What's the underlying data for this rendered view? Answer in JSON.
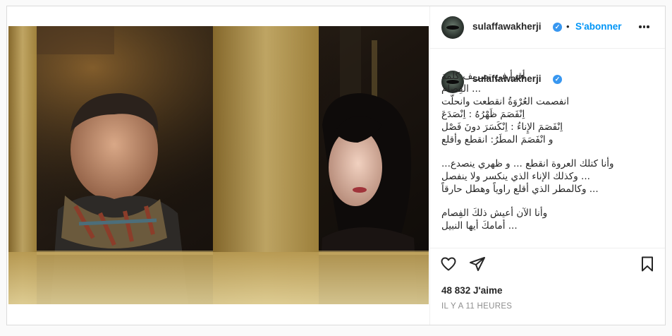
{
  "post": {
    "username": "sulaffawakherji",
    "follow_label": "S'abonner",
    "separator": "•",
    "verified_mark": "✓",
    "caption_lines": [
      "أقرأ في تصريف كلمة",
      "... الفِصام",
      "انفصمت العُرْوَةُ انقطعت وانحلّت",
      "اِنْفَصَمَ ظَهْرُهُ : اِنْصَدَعَ",
      "اِنْفَصَمَ الإِناءُ : اِنْكَسَرَ دونَ فَصْل",
      "و انْفَصَمَ المطَرُ: انقطع وأقلع",
      "",
      "وأنا كتلك العروة انقطع ... و ظهري ينصدع...",
      "... وكذلك الإناء الذي ينكسر ولا ينفصل",
      "... وكالمطر الذي أقلع راوياً وهطل حارقاً",
      "",
      "وأنا الآن أعيش ذلكَ الفِصام",
      "... أمامكَ أيها النبيل"
    ],
    "likes": "48 832 J'aime",
    "time": "IL Y A 11 HEURES"
  },
  "icons": {
    "like": "heart-icon",
    "share": "paper-plane-icon",
    "save": "bookmark-icon",
    "more": "more-options-icon"
  },
  "colors": {
    "accent": "#0095f6",
    "verified": "#3897f0",
    "text": "#262626",
    "muted": "#8e8e8e",
    "border": "#dbdbdb"
  }
}
